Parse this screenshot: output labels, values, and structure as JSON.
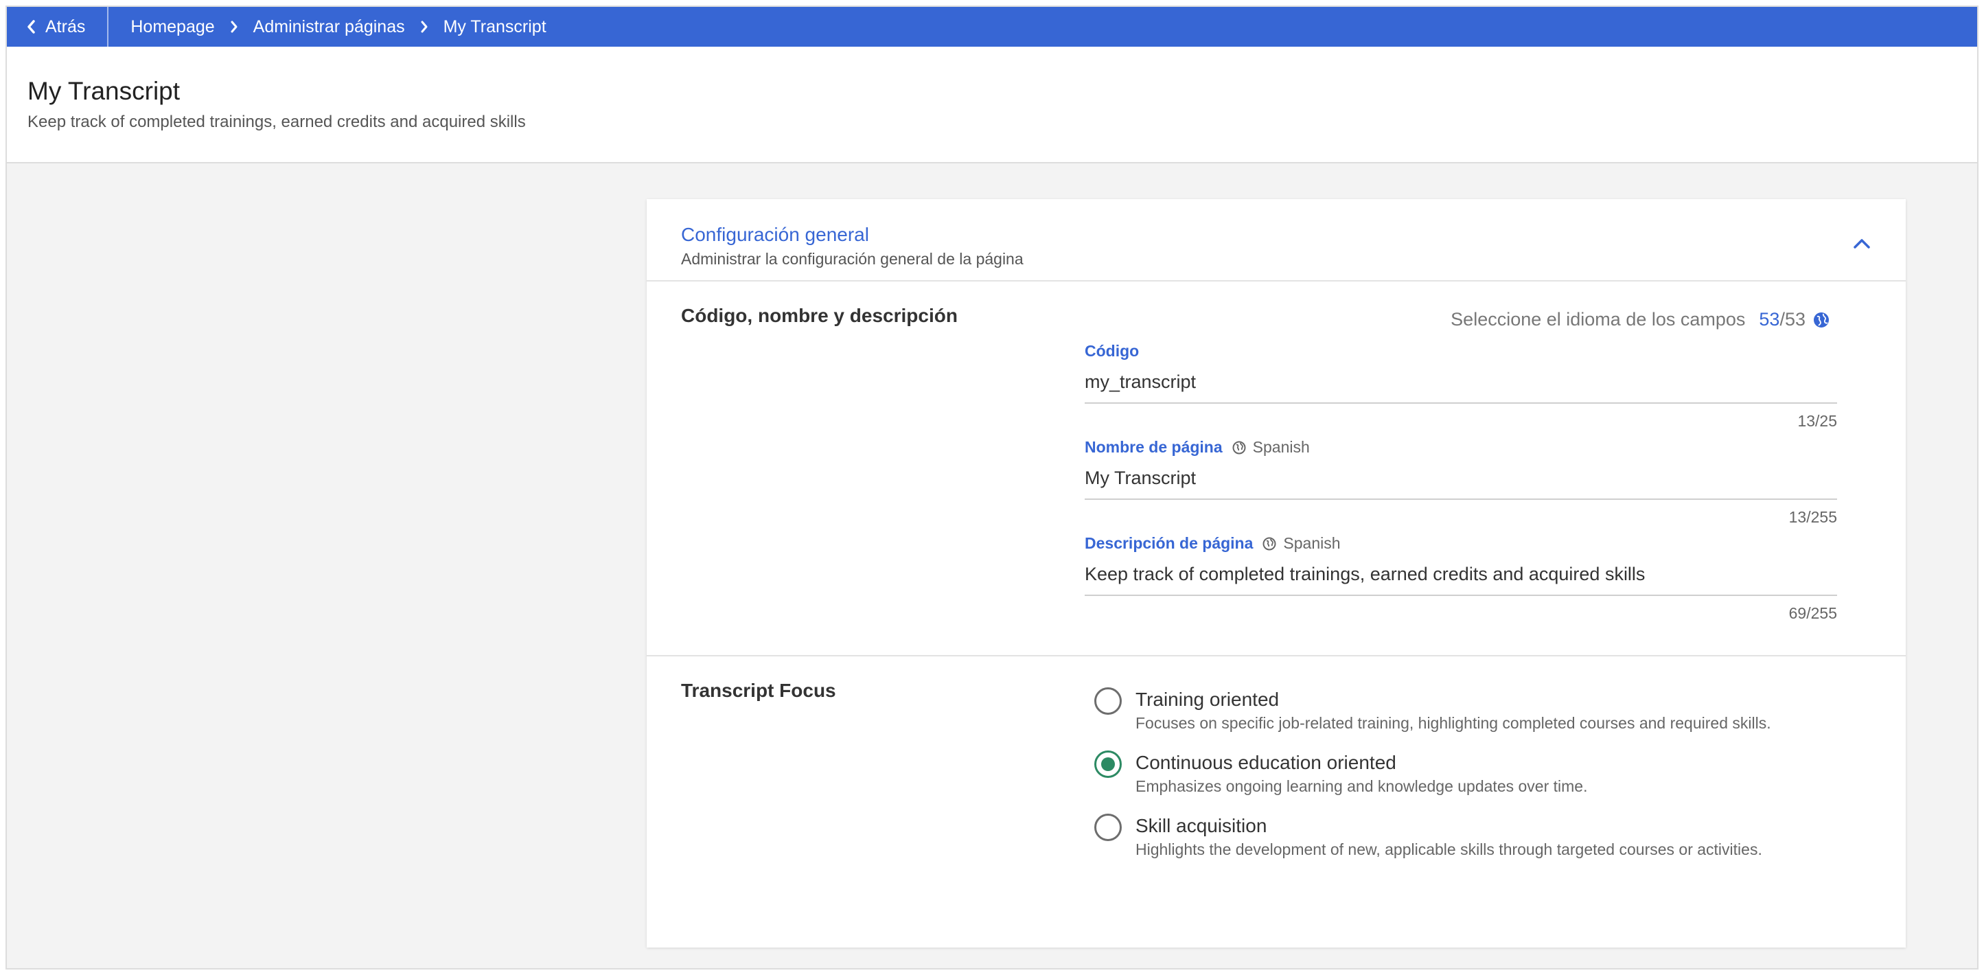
{
  "topbar": {
    "back_label": "Atrás",
    "breadcrumbs": [
      "Homepage",
      "Administrar páginas",
      "My Transcript"
    ],
    "color": "#3766d4"
  },
  "header": {
    "title": "My Transcript",
    "subtitle": "Keep track of completed trainings, earned credits and acquired skills"
  },
  "card": {
    "title": "Configuración general",
    "description": "Administrar la configuración general de la página",
    "expanded": true,
    "section1": {
      "label": "Código, nombre y descripción",
      "language_selector": {
        "text": "Seleccione el idioma de los campos",
        "count": "53",
        "total": "/53",
        "icon": "globe-icon"
      },
      "fields": {
        "code": {
          "label": "Código",
          "value": "my_transcript",
          "counter": "13/25"
        },
        "name": {
          "label": "Nombre de página",
          "language": "Spanish",
          "value": "My Transcript",
          "counter": "13/255"
        },
        "description": {
          "label": "Descripción de página",
          "language": "Spanish",
          "value": "Keep track of completed trainings, earned credits and acquired skills",
          "counter": "69/255"
        }
      }
    },
    "section2": {
      "label": "Transcript Focus",
      "options": [
        {
          "title": "Training oriented",
          "description": "Focuses on specific job-related training, highlighting completed courses and required skills.",
          "checked": false
        },
        {
          "title": "Continuous education oriented",
          "description": "Emphasizes ongoing learning and knowledge updates over time.",
          "checked": true
        },
        {
          "title": "Skill acquisition",
          "description": "Highlights the development of new, applicable skills through targeted courses or activities.",
          "checked": false
        }
      ],
      "selected_color": "#2c8a63"
    }
  }
}
